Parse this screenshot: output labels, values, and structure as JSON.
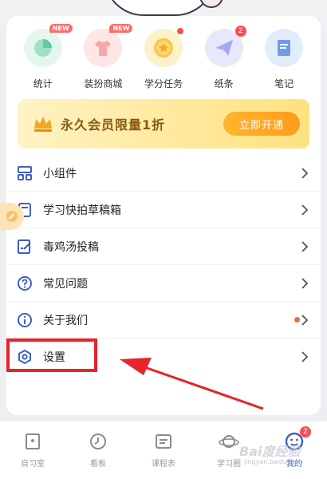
{
  "features": [
    {
      "label": "统计",
      "icon": "pie-chart-icon",
      "color": "#7fd6b5",
      "bg": "#e4f7ef",
      "badge": "NEW"
    },
    {
      "label": "装扮商城",
      "icon": "tshirt-icon",
      "color": "#f39a9a",
      "bg": "#fde6e6",
      "badge": "NEW"
    },
    {
      "label": "学分任务",
      "icon": "star-coin-icon",
      "color": "#f5c244",
      "bg": "#fdf1cc",
      "badge_dot": true
    },
    {
      "label": "纸条",
      "icon": "paper-plane-icon",
      "color": "#9a9ef0",
      "bg": "#e8e8fc",
      "badge_count": "2"
    },
    {
      "label": "笔记",
      "icon": "notebook-icon",
      "color": "#6a9ae8",
      "bg": "#e2ecfb"
    }
  ],
  "vip": {
    "text": "永久会员限量1折",
    "button": "立即开通",
    "crown_color": "#f5a623"
  },
  "menu": [
    {
      "label": "小组件",
      "icon": "widget-grid-icon"
    },
    {
      "label": "学习快拍草稿箱",
      "icon": "draft-box-icon"
    },
    {
      "label": "毒鸡汤投稿",
      "icon": "edit-submit-icon"
    },
    {
      "label": "常见问题",
      "icon": "question-icon"
    },
    {
      "label": "关于我们",
      "icon": "info-icon",
      "red_dot": true
    },
    {
      "label": "设置",
      "icon": "settings-icon"
    }
  ],
  "tabbar": [
    {
      "label": "自习室",
      "icon": "study-room-icon"
    },
    {
      "label": "看板",
      "icon": "clock-icon"
    },
    {
      "label": "课程表",
      "icon": "schedule-icon"
    },
    {
      "label": "学习圈",
      "icon": "planet-icon"
    },
    {
      "label": "我的",
      "icon": "profile-face-icon",
      "badge": "2",
      "active": true
    }
  ],
  "watermark": {
    "main": "Bai度经验",
    "sub": "jingyan.baidu.com"
  },
  "colors": {
    "accent": "#4a6fd6",
    "highlight": "#e8232a",
    "tab_inactive": "#9a9aa2"
  }
}
